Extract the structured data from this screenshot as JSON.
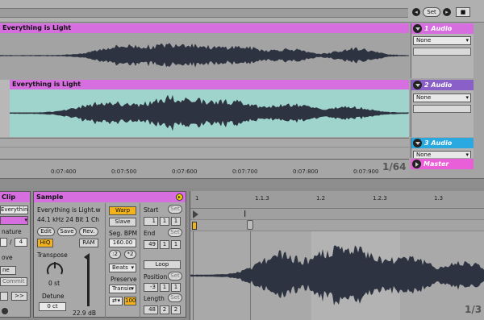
{
  "top_controls": {
    "set_label": "Set"
  },
  "tracks": [
    {
      "clip_name": "Everything is Light",
      "track_name": "1 Audio",
      "input": "None",
      "color": "#d66ee0"
    },
    {
      "clip_name": "Everything is Light",
      "track_name": "2 Audio",
      "input": "None",
      "color": "#a16fd8"
    },
    {
      "clip_name": "",
      "track_name": "3 Audio",
      "input": "None",
      "color": "#2aa9e0"
    },
    {
      "clip_name": "",
      "track_name": "Master",
      "input": "",
      "color": "#e85fd8"
    }
  ],
  "timeline": {
    "ticks": [
      "0:07:400",
      "0:07:500",
      "0:07:600",
      "0:07:700",
      "0:07:800",
      "0:07:900"
    ],
    "quantize": "1/64"
  },
  "clip_panel": {
    "title": "Clip",
    "name": "Everything is",
    "signature_label": "nature",
    "sig_denominator": "4",
    "move_label": "ove",
    "ne_label": "ne",
    "commit_label": "Commit",
    "nav_next": ">>"
  },
  "sample_panel": {
    "title": "Sample",
    "file": "Everything is Light.w",
    "info": "44.1 kHz 24 Bit 1 Ch",
    "edit": "Edit",
    "save": "Save",
    "rev": "Rev.",
    "hiq": "HiQ",
    "ram": "RAM",
    "transpose_label": "Transpose",
    "transpose_value": "0 st",
    "detune_label": "Detune",
    "detune_value": "0 ct",
    "volume_value": "22.9 dB",
    "warp": "Warp",
    "slave": "Slave",
    "seg_bpm_label": "Seg. BPM",
    "seg_bpm_value": "160.00",
    "half": ":2",
    "double": "*2",
    "mode": "Beats",
    "preserve_label": "Preserve",
    "preserve_value": "Transie",
    "loop_value": "100",
    "start_label": "Start",
    "start_set": "Set",
    "start_values": [
      "1",
      "1",
      "1"
    ],
    "end_label": "End",
    "end_set": "Set",
    "end_values": [
      "49",
      "1",
      "1"
    ],
    "loop_label": "Loop",
    "position_label": "Position",
    "position_set": "Set",
    "position_values": [
      "-3",
      "1",
      "1"
    ],
    "length_label": "Length",
    "length_set": "Set",
    "length_values": [
      "48",
      "2",
      "2"
    ]
  },
  "sample_display": {
    "ruler": [
      "1",
      "1.1.3",
      "1.2",
      "1.2.3",
      "1.3"
    ],
    "zoom": "1/3"
  }
}
